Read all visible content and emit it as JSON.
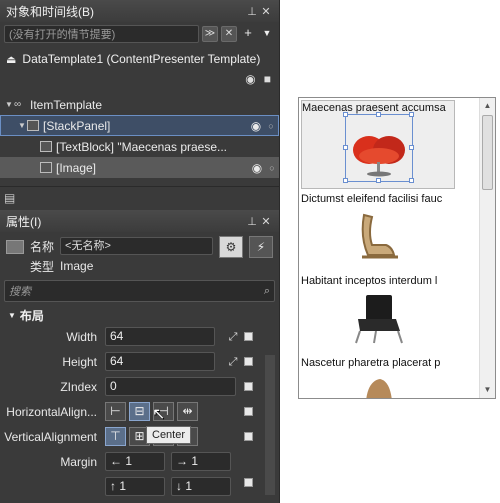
{
  "objects_panel": {
    "title": "对象和时间线(B)",
    "search_placeholder": "(没有打开的情节提要)",
    "template_title": "DataTemplate1 (ContentPresenter Template)",
    "tree": [
      {
        "label": "ItemTemplate",
        "level": 0
      },
      {
        "label": "[StackPanel]",
        "level": 1,
        "selected": true
      },
      {
        "label": "[TextBlock] \"Maecenas praese...",
        "level": 2
      },
      {
        "label": "[Image]",
        "level": 2,
        "highlighted": true
      }
    ]
  },
  "properties_panel": {
    "title": "属性(I)",
    "name_label": "名称",
    "name_value": "<无名称>",
    "type_label": "类型",
    "type_value": "Image",
    "search_placeholder": "搜索",
    "category": "布局",
    "props": {
      "width_label": "Width",
      "width_value": "64",
      "height_label": "Height",
      "height_value": "64",
      "zindex_label": "ZIndex",
      "zindex_value": "0",
      "halign_label": "HorizontalAlign...",
      "valign_label": "VerticalAlignment",
      "margin_label": "Margin",
      "margin_values": [
        "1",
        "1",
        "1",
        "1"
      ]
    },
    "tooltip": "Center"
  },
  "preview": {
    "items": [
      {
        "text": "Maecenas praesent accumsa",
        "image": "red-egg-chair",
        "selected": true
      },
      {
        "text": "Dictumst eleifend facilisi fauc",
        "image": "wooden-lounge-chair"
      },
      {
        "text": "Habitant inceptos interdum l",
        "image": "black-leather-chair"
      },
      {
        "text": "Nascetur pharetra placerat p",
        "image": "brown-chair"
      }
    ]
  },
  "colors": {
    "panel_bg": "#3a3a3a",
    "selection_blue": "#6a8fd0",
    "chair_red": "#d9301c"
  }
}
